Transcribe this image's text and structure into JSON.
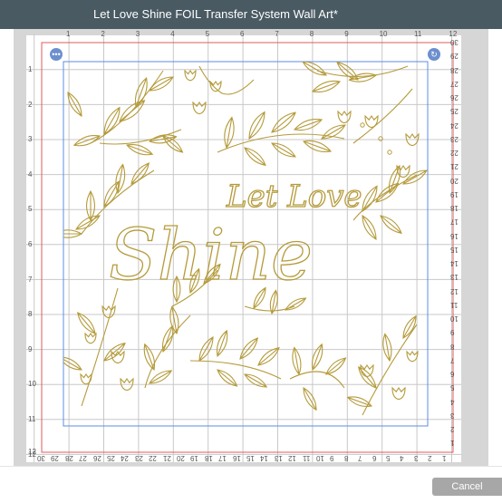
{
  "window": {
    "title": "Let Love Shine FOIL Transfer System Wall Art*"
  },
  "mat": {
    "top_ruler": [
      "1",
      "2",
      "3",
      "4",
      "5",
      "6",
      "7",
      "8",
      "9",
      "10",
      "11",
      "12"
    ],
    "left_ruler": [
      "1",
      "2",
      "3",
      "4",
      "5",
      "6",
      "7",
      "8",
      "9",
      "10",
      "11",
      "12"
    ],
    "right_ruler": [
      "30",
      "29",
      "28",
      "27",
      "26",
      "25",
      "24",
      "23",
      "22",
      "21",
      "20",
      "19",
      "18",
      "17",
      "16",
      "15",
      "14",
      "13",
      "12",
      "11",
      "10",
      "9",
      "8",
      "7",
      "6",
      "5",
      "4",
      "3",
      "2",
      "1"
    ],
    "bottom_ruler": [
      "30",
      "29",
      "28",
      "27",
      "26",
      "25",
      "24",
      "23",
      "22",
      "21",
      "20",
      "19",
      "18",
      "17",
      "16",
      "15",
      "14",
      "13",
      "12",
      "11",
      "10",
      "9",
      "8",
      "7",
      "6",
      "5",
      "4",
      "3",
      "2",
      "1"
    ]
  },
  "controls": {
    "more_label": "•••",
    "rotate_label": "↻"
  },
  "artwork": {
    "line1": "Let Love",
    "line2": "Shine",
    "foil_color": "#b59b3b"
  },
  "footer": {
    "cancel_label": "Cancel"
  }
}
